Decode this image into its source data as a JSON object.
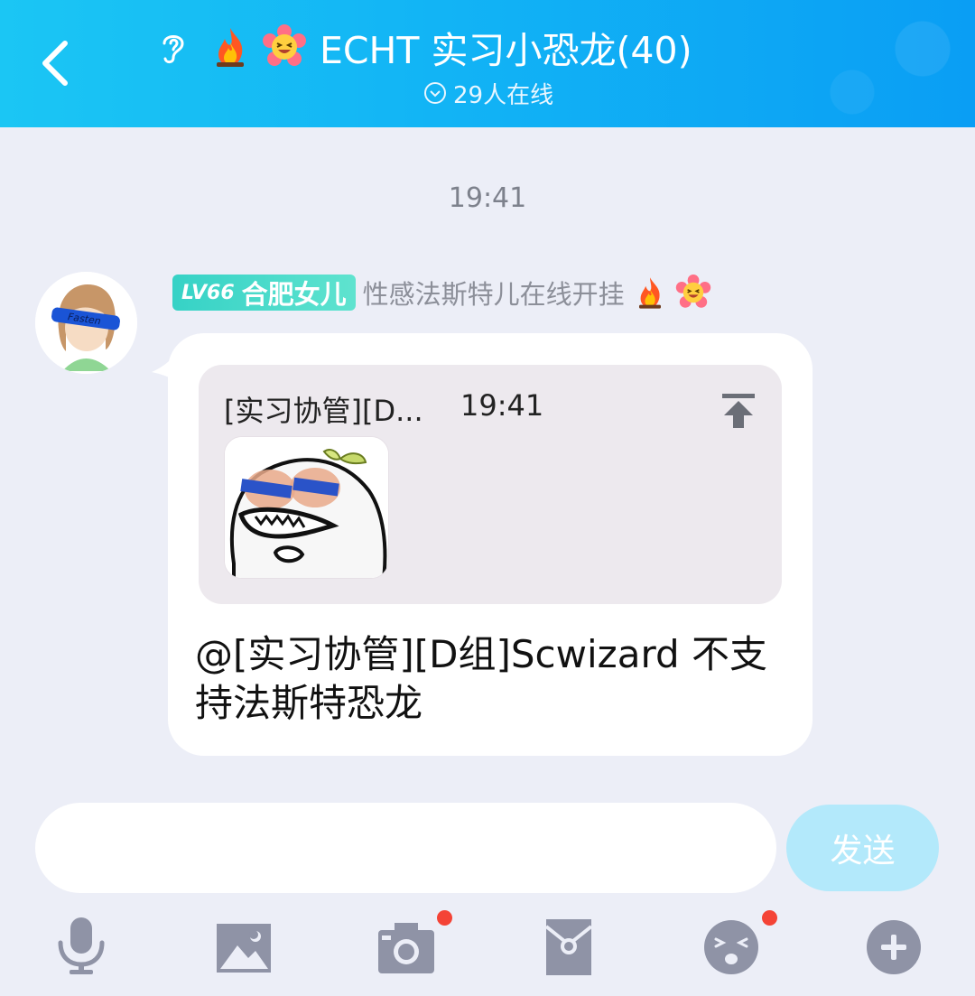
{
  "header": {
    "group_name": "ECHT 实习小恐龙(40)",
    "online_count": "29人在线"
  },
  "chat": {
    "timestamp": "19:41",
    "message": {
      "level_badge": "LV66",
      "title_badge": "合肥女儿",
      "nickname": "性感法斯特儿在线开挂",
      "reply": {
        "sender": "[实习协管][D...",
        "time": "19:41"
      },
      "text": "@[实习协管][D组]Scwizard 不支持法斯特恐龙"
    }
  },
  "composer": {
    "input_value": "",
    "send_label": "发送"
  },
  "toolbar": {
    "icons": [
      "microphone-icon",
      "image-icon",
      "camera-icon",
      "red-packet-icon",
      "emoji-icon",
      "plus-icon"
    ]
  },
  "colors": {
    "header_gradient_start": "#1bc6f4",
    "header_gradient_end": "#0a9ef4",
    "background": "#eceef7",
    "send_button": "#b3e9fb",
    "toolbar_icon": "#8f93a6",
    "notification_dot": "#f44336"
  }
}
